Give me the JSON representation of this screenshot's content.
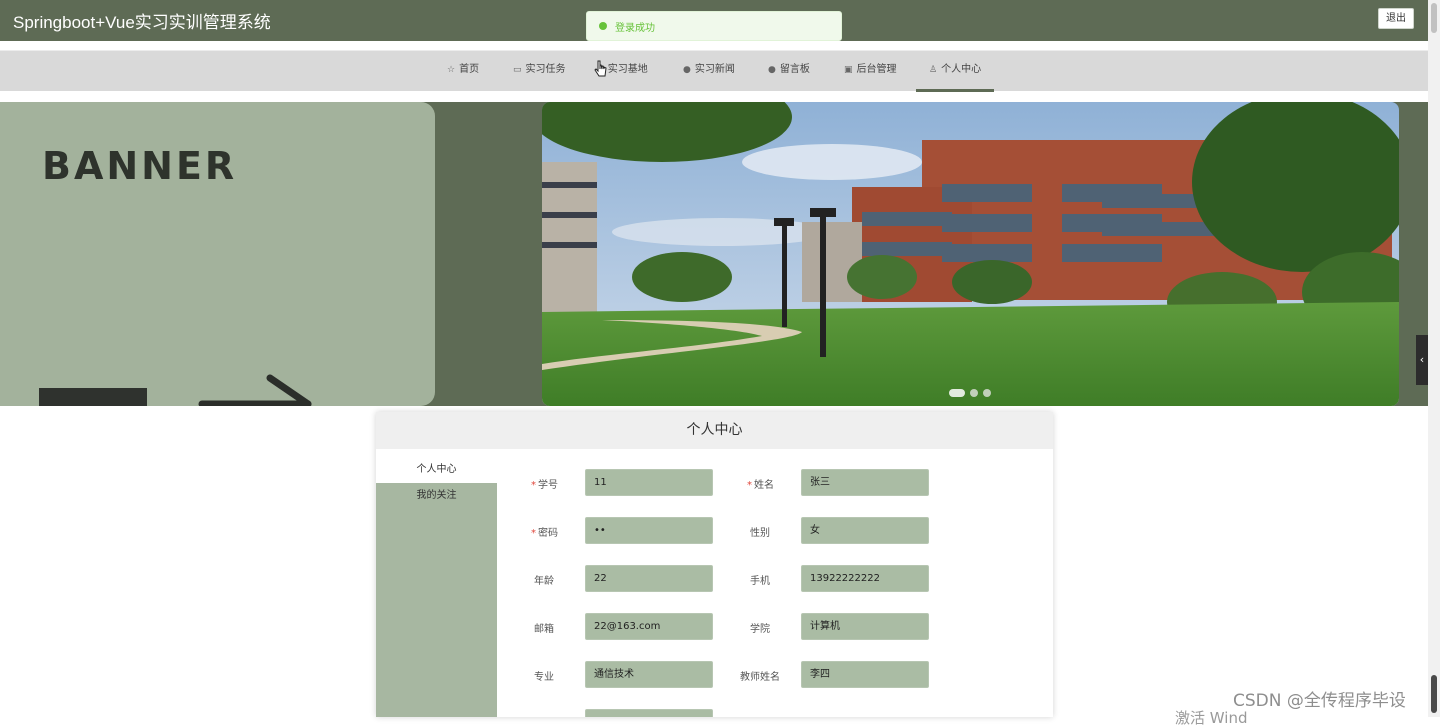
{
  "app": {
    "title": "Springboot+Vue实习实训管理系统",
    "logout_label": "退出"
  },
  "toast": {
    "message": "登录成功"
  },
  "nav": {
    "items": [
      {
        "label": "首页",
        "icon": "star-icon"
      },
      {
        "label": "实习任务",
        "icon": "briefcase-icon"
      },
      {
        "label": "实习基地",
        "icon": "home-icon"
      },
      {
        "label": "实习新闻",
        "icon": "question-icon"
      },
      {
        "label": "留言板",
        "icon": "info-icon"
      },
      {
        "label": "后台管理",
        "icon": "box-icon"
      },
      {
        "label": "个人中心",
        "icon": "user-icon"
      }
    ],
    "active": "个人中心"
  },
  "banner": {
    "word": "BANNER",
    "slide_count": 3,
    "active_slide": 1
  },
  "panel": {
    "title": "个人中心",
    "menu": [
      {
        "label": "个人中心"
      },
      {
        "label": "我的关注"
      }
    ],
    "fields": {
      "student_id": {
        "label": "学号",
        "value": "11",
        "required": true
      },
      "name": {
        "label": "姓名",
        "value": "张三",
        "required": true
      },
      "password": {
        "label": "密码",
        "value": "••",
        "required": true
      },
      "gender": {
        "label": "性别",
        "value": "女"
      },
      "age": {
        "label": "年龄",
        "value": "22"
      },
      "phone": {
        "label": "手机",
        "value": "13922222222"
      },
      "email": {
        "label": "邮箱",
        "value": "22@163.com"
      },
      "college": {
        "label": "学院",
        "value": "计算机"
      },
      "major": {
        "label": "专业",
        "value": "通信技术"
      },
      "teacher": {
        "label": "教师姓名",
        "value": "李四"
      }
    }
  },
  "watermark": {
    "text": "CSDN @全传程序毕设",
    "text2": "激活 Wind"
  },
  "colors": {
    "header": "#5e6b55",
    "field": "#aabca4",
    "menu": "#a7b7a1",
    "success": "#67c23a"
  }
}
